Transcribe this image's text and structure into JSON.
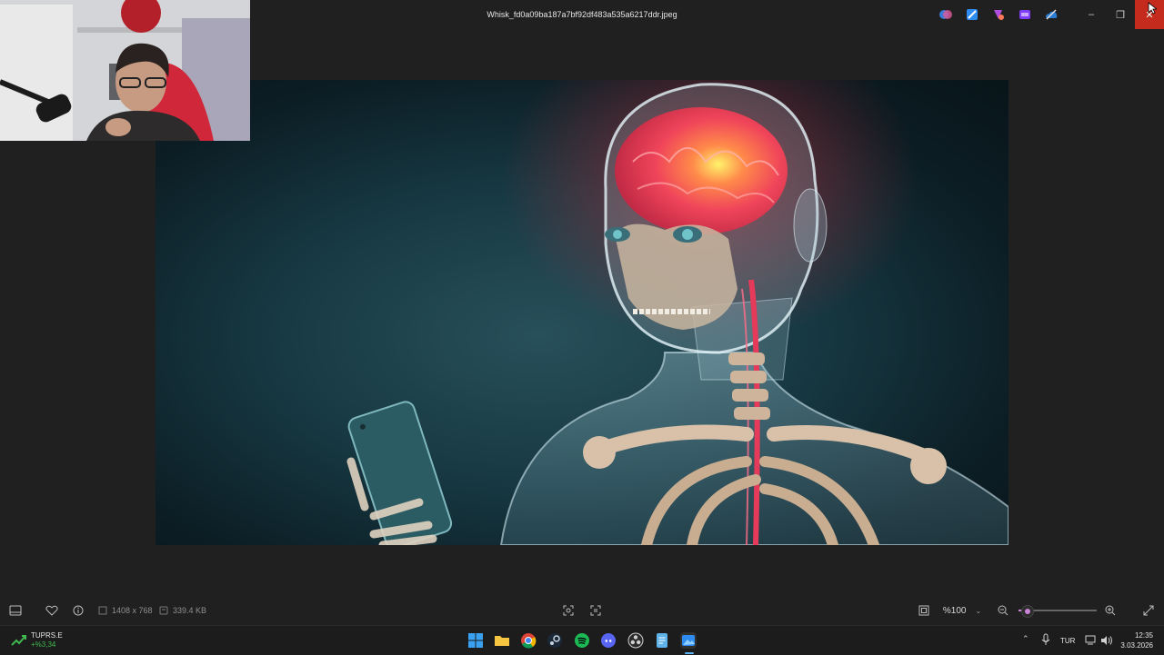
{
  "window": {
    "title": "Whisk_fd0a09ba187a7bf92df483a535a6217ddr.jpeg",
    "controls": {
      "minimize": "–",
      "restore": "❐",
      "close": "✕"
    }
  },
  "toolbar": {
    "dimensions": "1408 x 768",
    "file_size": "339.4 KB",
    "zoom": "%100",
    "zoom_level": 0.1
  },
  "taskbar": {
    "stock_symbol": "TUPRS.E",
    "stock_change": "+%3,34",
    "language": "TUR",
    "time": "12:35",
    "date": "3.03.2026"
  },
  "colors": {
    "accent": "#c984d6",
    "close_red": "#c42b1c",
    "stock_green": "#3fb950"
  }
}
